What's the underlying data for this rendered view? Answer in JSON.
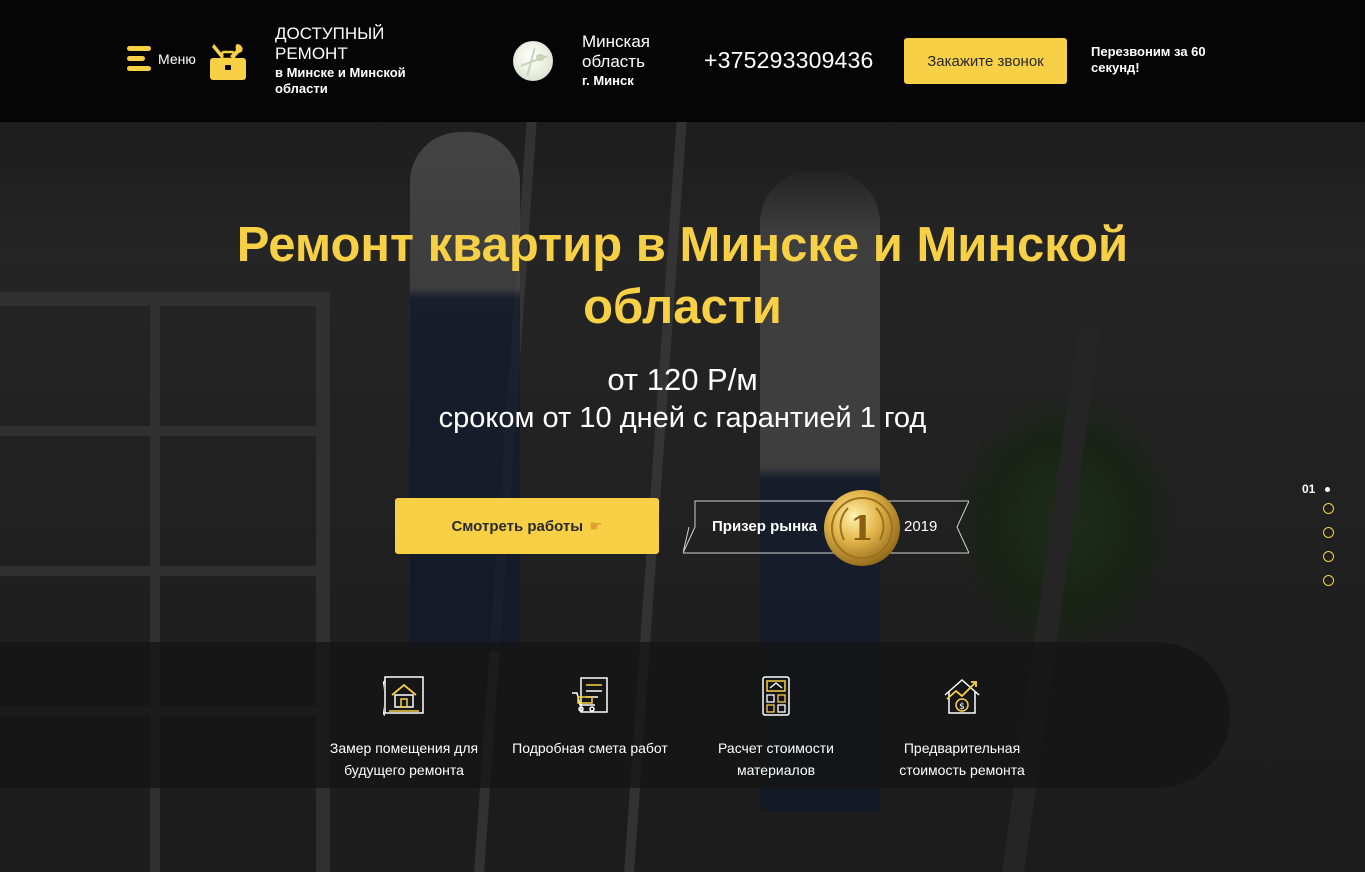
{
  "header": {
    "menu_label": "Меню",
    "logo_title_line1": "ДОСТУПНЫЙ",
    "logo_title_line2": "РЕМОНТ",
    "logo_subtitle": "в Минске и Минской области",
    "region_title_line1": "Минская",
    "region_title_line2": "область",
    "region_city": "г. Минск",
    "phone": "+375293309436",
    "call_button_label": "Закажите звонок",
    "callback_note": "Перезвоним за 60 секунд!"
  },
  "hero": {
    "title": "Ремонт квартир в Минске и Минской области",
    "price": "от 120 Р/м",
    "terms": "сроком от 10 дней с гарантией 1 год",
    "works_button_label": "Смотреть работы",
    "award_label": "Призер рынка",
    "award_year": "2019",
    "medal_number": "1"
  },
  "pager": {
    "current": "01",
    "total_slides": 5
  },
  "features": [
    {
      "icon": "blueprint-house-icon",
      "label": "Замер помещения для будущего ремонта"
    },
    {
      "icon": "estimate-document-icon",
      "label": "Подробная смета работ"
    },
    {
      "icon": "calculator-icon",
      "label": "Расчет стоимости материалов"
    },
    {
      "icon": "price-growth-house-icon",
      "label": "Предварительная стоимость ремонта"
    }
  ],
  "colors": {
    "accent": "#f7d046",
    "header_bg": "#050505",
    "button_text": "#2a2a2a"
  }
}
